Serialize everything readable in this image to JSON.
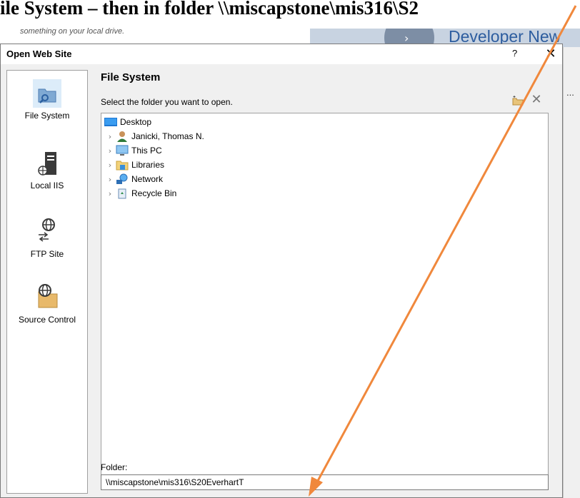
{
  "doc": {
    "heading": "ile System – then in folder \\\\miscapstone\\mis316\\S2",
    "hint": "something on your local drive."
  },
  "background": {
    "banner_title": "Developer New",
    "ellipsis": "..."
  },
  "dialog": {
    "title": "Open Web Site",
    "help": "?",
    "close": "✕",
    "nav": [
      {
        "label": "File System",
        "icon": "file-system-icon"
      },
      {
        "label": "Local IIS",
        "icon": "local-iis-icon"
      },
      {
        "label": "FTP Site",
        "icon": "ftp-site-icon"
      },
      {
        "label": "Source Control",
        "icon": "source-control-icon"
      }
    ],
    "panel": {
      "title": "File System",
      "description": "Select the folder you want to open.",
      "tree": [
        {
          "label": "Desktop",
          "icon": "desktop-icon",
          "level": 0,
          "expandable": false
        },
        {
          "label": "Janicki, Thomas N.",
          "icon": "user-icon",
          "level": 1,
          "expandable": true
        },
        {
          "label": "This PC",
          "icon": "computer-icon",
          "level": 1,
          "expandable": true
        },
        {
          "label": "Libraries",
          "icon": "libraries-icon",
          "level": 1,
          "expandable": true
        },
        {
          "label": "Network",
          "icon": "network-icon",
          "level": 1,
          "expandable": true
        },
        {
          "label": "Recycle Bin",
          "icon": "recycle-bin-icon",
          "level": 1,
          "expandable": true
        }
      ],
      "folder_label": "Folder:",
      "folder_value": "\\\\miscapstone\\mis316\\S20EverhartT"
    }
  },
  "colors": {
    "annotation_arrow": "#f0883c",
    "dialog_bg": "#f0f0f0",
    "accent": "#2d5d9f"
  }
}
